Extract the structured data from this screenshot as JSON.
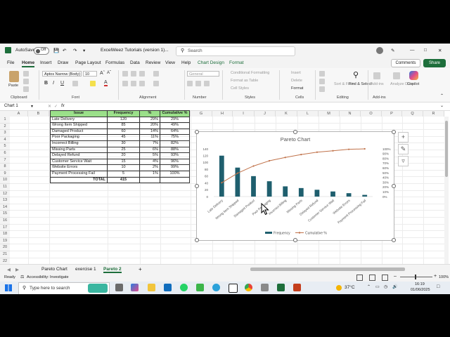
{
  "titlebar": {
    "autosave_label": "AutoSave",
    "autosave_state": "Off",
    "document_title": "ExcelWeez Tutorials (version 1)...",
    "search_placeholder": "Search"
  },
  "menu": {
    "tabs": [
      "File",
      "Home",
      "Insert",
      "Draw",
      "Page Layout",
      "Formulas",
      "Data",
      "Review",
      "View",
      "Help",
      "Chart Design",
      "Format"
    ],
    "comments_label": "Comments",
    "share_label": "Share"
  },
  "ribbon": {
    "paste_label": "Paste",
    "font_name": "Aptos Narrow (Body)",
    "font_size": "10",
    "groups": [
      "Clipboard",
      "Font",
      "Alignment",
      "Number",
      "Styles",
      "Cells",
      "Editing",
      "Add-ins"
    ],
    "number_format": "General",
    "conditional_formatting": "Conditional Formatting",
    "format_as_table": "Format as Table",
    "cell_styles": "Cell Styles",
    "insert": "Insert",
    "delete": "Delete",
    "format": "Format",
    "sort_filter": "Sort & Filter",
    "find_select": "Find & Select",
    "addins": "Add-ins",
    "analyze_data": "Analyze Data",
    "copilot": "Copilot"
  },
  "formula_bar": {
    "name_box": "Chart 1",
    "fx": "fx"
  },
  "grid": {
    "columns": [
      "A",
      "B",
      "C",
      "D",
      "E",
      "F",
      "G",
      "H",
      "I",
      "J",
      "K",
      "L",
      "M",
      "N",
      "O",
      "P",
      "Q",
      "R"
    ],
    "rows": [
      "1",
      "2",
      "3",
      "4",
      "5",
      "6",
      "7",
      "8",
      "9",
      "10",
      "11",
      "12",
      "13",
      "14",
      "15",
      "16",
      "17",
      "18",
      "19",
      "20",
      "21",
      "22"
    ]
  },
  "table": {
    "headers": [
      "Issue",
      "Frequency",
      "%",
      "Cumulative %"
    ],
    "rows": [
      [
        "Late Delivery",
        "120",
        "29%",
        "29%"
      ],
      [
        "Wrong Item Shipped",
        "85",
        "20%",
        "49%"
      ],
      [
        "Damaged Product",
        "60",
        "14%",
        "64%"
      ],
      [
        "Poor Packaging",
        "45",
        "11%",
        "75%"
      ],
      [
        "Incorrect Billing",
        "30",
        "7%",
        "82%"
      ],
      [
        "Missing Parts",
        "25",
        "6%",
        "88%"
      ],
      [
        "Delayed Refund",
        "20",
        "5%",
        "93%"
      ],
      [
        "Customer Service Wait",
        "15",
        "4%",
        "96%"
      ],
      [
        "Website Errors",
        "10",
        "2%",
        "99%"
      ],
      [
        "Payment Processing Fail",
        "5",
        "1%",
        "100%"
      ]
    ],
    "total_label": "TOTAL",
    "total_value": "415"
  },
  "chart_data": {
    "type": "bar",
    "title": "Pareto Chart",
    "categories": [
      "Late Delivery",
      "Wrong Item Shipped",
      "Damaged Product",
      "Poor Packaging",
      "Incorrect Billing",
      "Missing Parts",
      "Delayed Refund",
      "Customer Service Wait",
      "Website Errors",
      "Payment Processing Fail"
    ],
    "series": [
      {
        "name": "Frequency",
        "type": "bar",
        "axis": "left",
        "color": "#1f5f6e",
        "values": [
          120,
          85,
          60,
          45,
          30,
          25,
          20,
          15,
          10,
          5
        ]
      },
      {
        "name": "Cumulative %",
        "type": "line",
        "axis": "right",
        "color": "#c0724a",
        "values": [
          29,
          49,
          64,
          75,
          82,
          88,
          93,
          96,
          99,
          100
        ]
      }
    ],
    "y_left_ticks": [
      "140",
      "120",
      "100",
      "80",
      "60",
      "40",
      "20",
      "0"
    ],
    "y_left_lim": [
      0,
      140
    ],
    "y_right_ticks": [
      "100%",
      "90%",
      "80%",
      "70%",
      "60%",
      "50%",
      "40%",
      "30%",
      "20%",
      "10%",
      "0%"
    ],
    "y_right_lim": [
      0,
      100
    ],
    "legend_position": "bottom",
    "grid": false
  },
  "sheet_tabs": {
    "tabs": [
      "Pareto Chart",
      "exercise 1",
      "Pareto 2"
    ],
    "active_index": 2
  },
  "status": {
    "ready": "Ready",
    "accessibility": "Accessibility: Investigate",
    "zoom": "100%"
  },
  "taskbar": {
    "search_placeholder": "Type here to search",
    "weather": "37°C",
    "time": "16:19",
    "date": "01/06/2025"
  },
  "colors": {
    "excel_green": "#1d6e3b",
    "header_fill": "#9be08a",
    "bar_color": "#1f5f6e",
    "line_color": "#c0724a"
  }
}
